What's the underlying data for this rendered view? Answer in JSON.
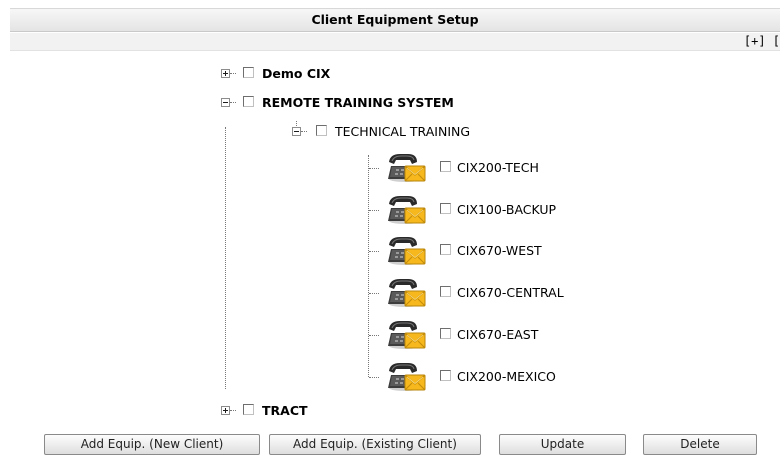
{
  "header": {
    "title": "Client Equipment Setup"
  },
  "expand_controls": {
    "label": "[+] ["
  },
  "tree": {
    "nodes": [
      {
        "label": "Demo CIX",
        "state": "collapsed"
      },
      {
        "label": "REMOTE TRAINING SYSTEM",
        "state": "expanded"
      },
      {
        "label": "TECHNICAL TRAINING",
        "state": "expanded"
      },
      {
        "label": "CIX200-TECH",
        "icon": "phone-mail-icon"
      },
      {
        "label": "CIX100-BACKUP",
        "icon": "phone-mail-icon"
      },
      {
        "label": "CIX670-WEST",
        "icon": "phone-mail-icon"
      },
      {
        "label": "CIX670-CENTRAL",
        "icon": "phone-mail-icon"
      },
      {
        "label": "CIX670-EAST",
        "icon": "phone-mail-icon"
      },
      {
        "label": "CIX200-MEXICO",
        "icon": "phone-mail-icon"
      },
      {
        "label": "TRACT",
        "state": "collapsed"
      }
    ]
  },
  "buttons": {
    "add_new": "Add Equip. (New Client)",
    "add_existing": "Add Equip. (Existing Client)",
    "update": "Update",
    "delete": "Delete"
  },
  "colors": {
    "title_bar": "#e8e8e8",
    "envelope": "#f5b820",
    "phone": "#3a3a3a"
  }
}
